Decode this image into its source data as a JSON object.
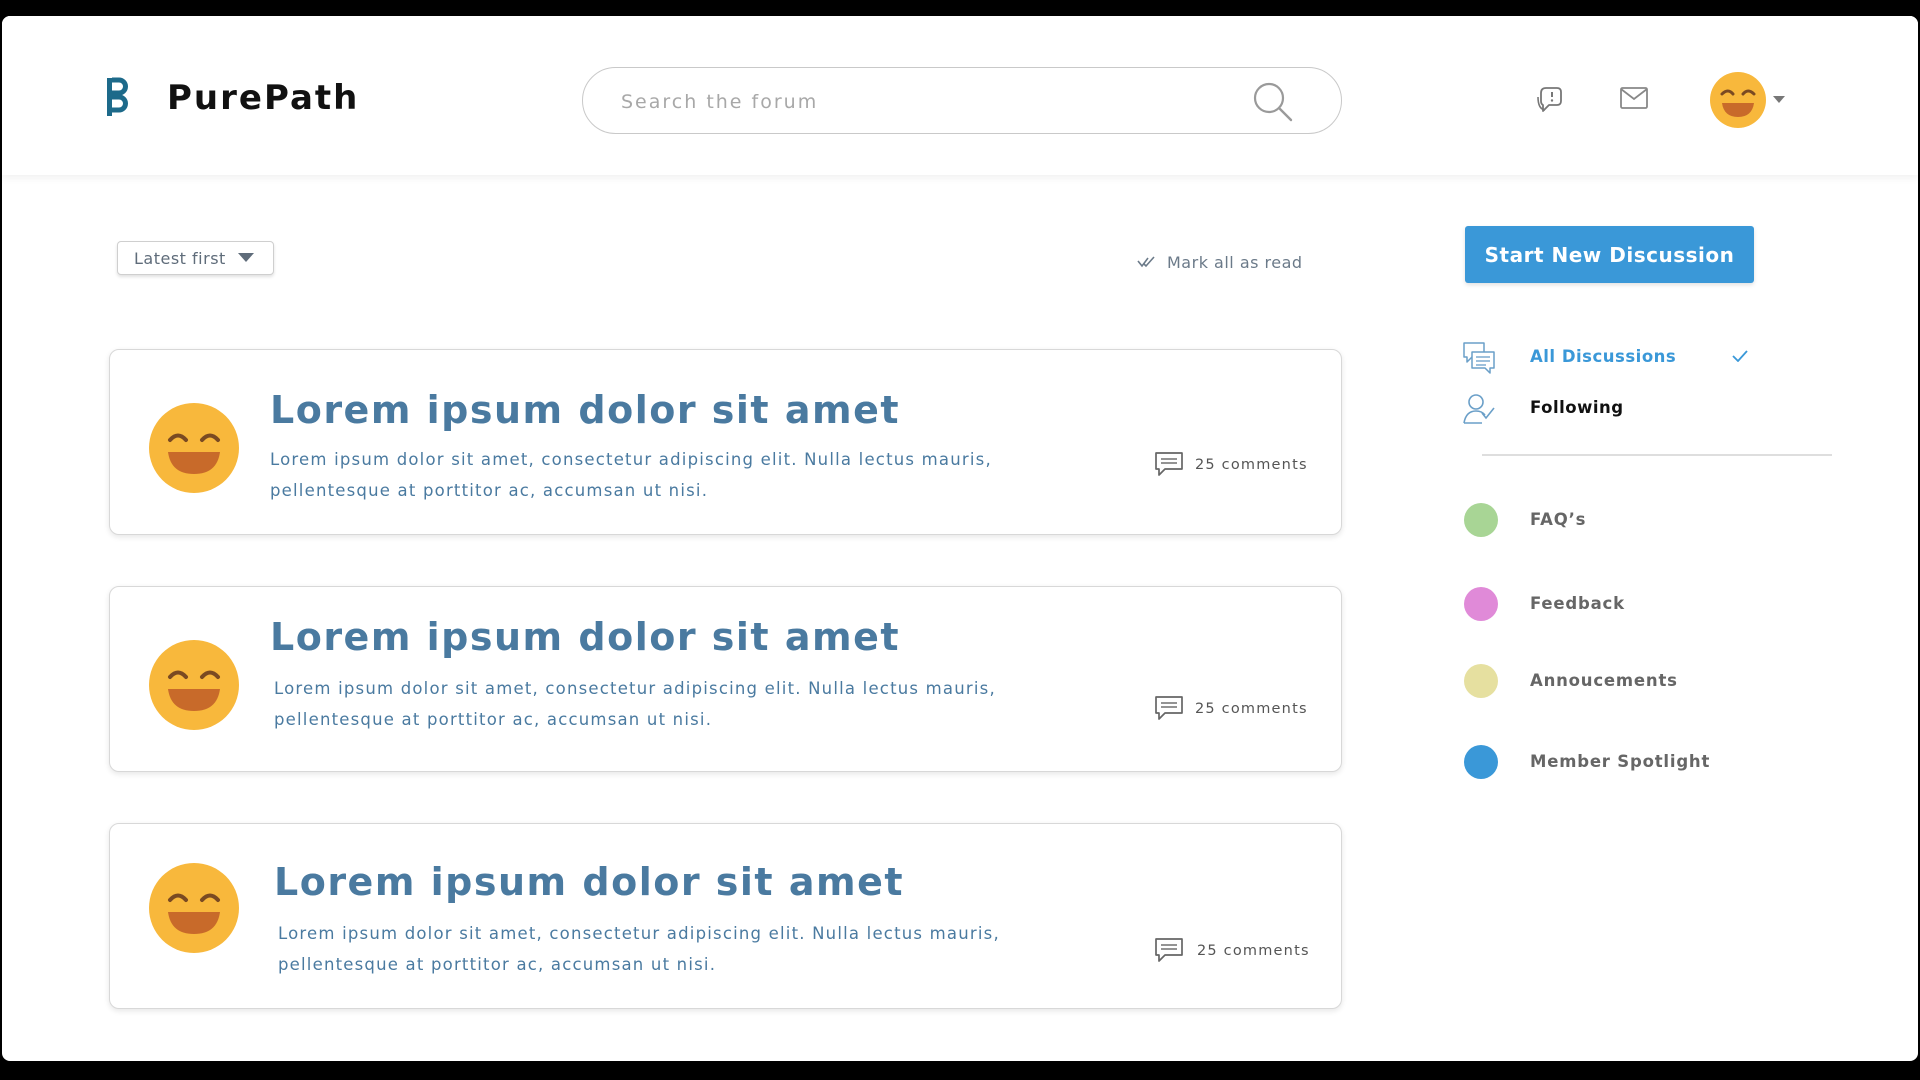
{
  "header": {
    "brand": "PurePath",
    "search_placeholder": "Search the forum"
  },
  "toolbar": {
    "sort_label": "Latest first",
    "mark_read_label": "Mark all as read"
  },
  "posts": [
    {
      "title": "Lorem ipsum dolor sit amet",
      "excerpt": "Lorem ipsum dolor sit amet, consectetur adipiscing elit. Nulla lectus mauris, pellentesque at porttitor ac, accumsan ut nisi.",
      "comments": "25 comments"
    },
    {
      "title": "Lorem ipsum dolor sit amet",
      "excerpt": "Lorem ipsum dolor sit amet, consectetur adipiscing elit. Nulla lectus mauris, pellentesque at porttitor ac, accumsan ut nisi.",
      "comments": "25 comments"
    },
    {
      "title": "Lorem ipsum dolor sit amet",
      "excerpt": "Lorem ipsum dolor sit amet, consectetur adipiscing elit. Nulla lectus mauris, pellentesque at porttitor ac, accumsan ut nisi.",
      "comments": "25 comments"
    }
  ],
  "sidebar": {
    "new_discussion_label": "Start New Discussion",
    "nav": [
      {
        "label": "All Discussions",
        "active": true,
        "icon": "discussions-icon"
      },
      {
        "label": "Following",
        "active": false,
        "icon": "following-icon"
      }
    ],
    "categories": [
      {
        "label": "FAQ’s",
        "color": "#a8d595"
      },
      {
        "label": "Feedback",
        "color": "#e08ad8"
      },
      {
        "label": "Annoucements",
        "color": "#e6e0a0"
      },
      {
        "label": "Member Spotlight",
        "color": "#3a98d8"
      }
    ]
  },
  "colors": {
    "accent": "#3a98d8",
    "title_blue": "#4a7aa0",
    "brand_teal": "#1d6a8a",
    "emoji_yellow": "#f8b83c",
    "emoji_mouth": "#c86a2a"
  },
  "icons": [
    "logo-icon",
    "search-icon",
    "notification-icon",
    "mail-icon",
    "avatar-emoji-icon",
    "chevron-down-icon",
    "double-check-icon",
    "comment-icon",
    "check-icon"
  ]
}
